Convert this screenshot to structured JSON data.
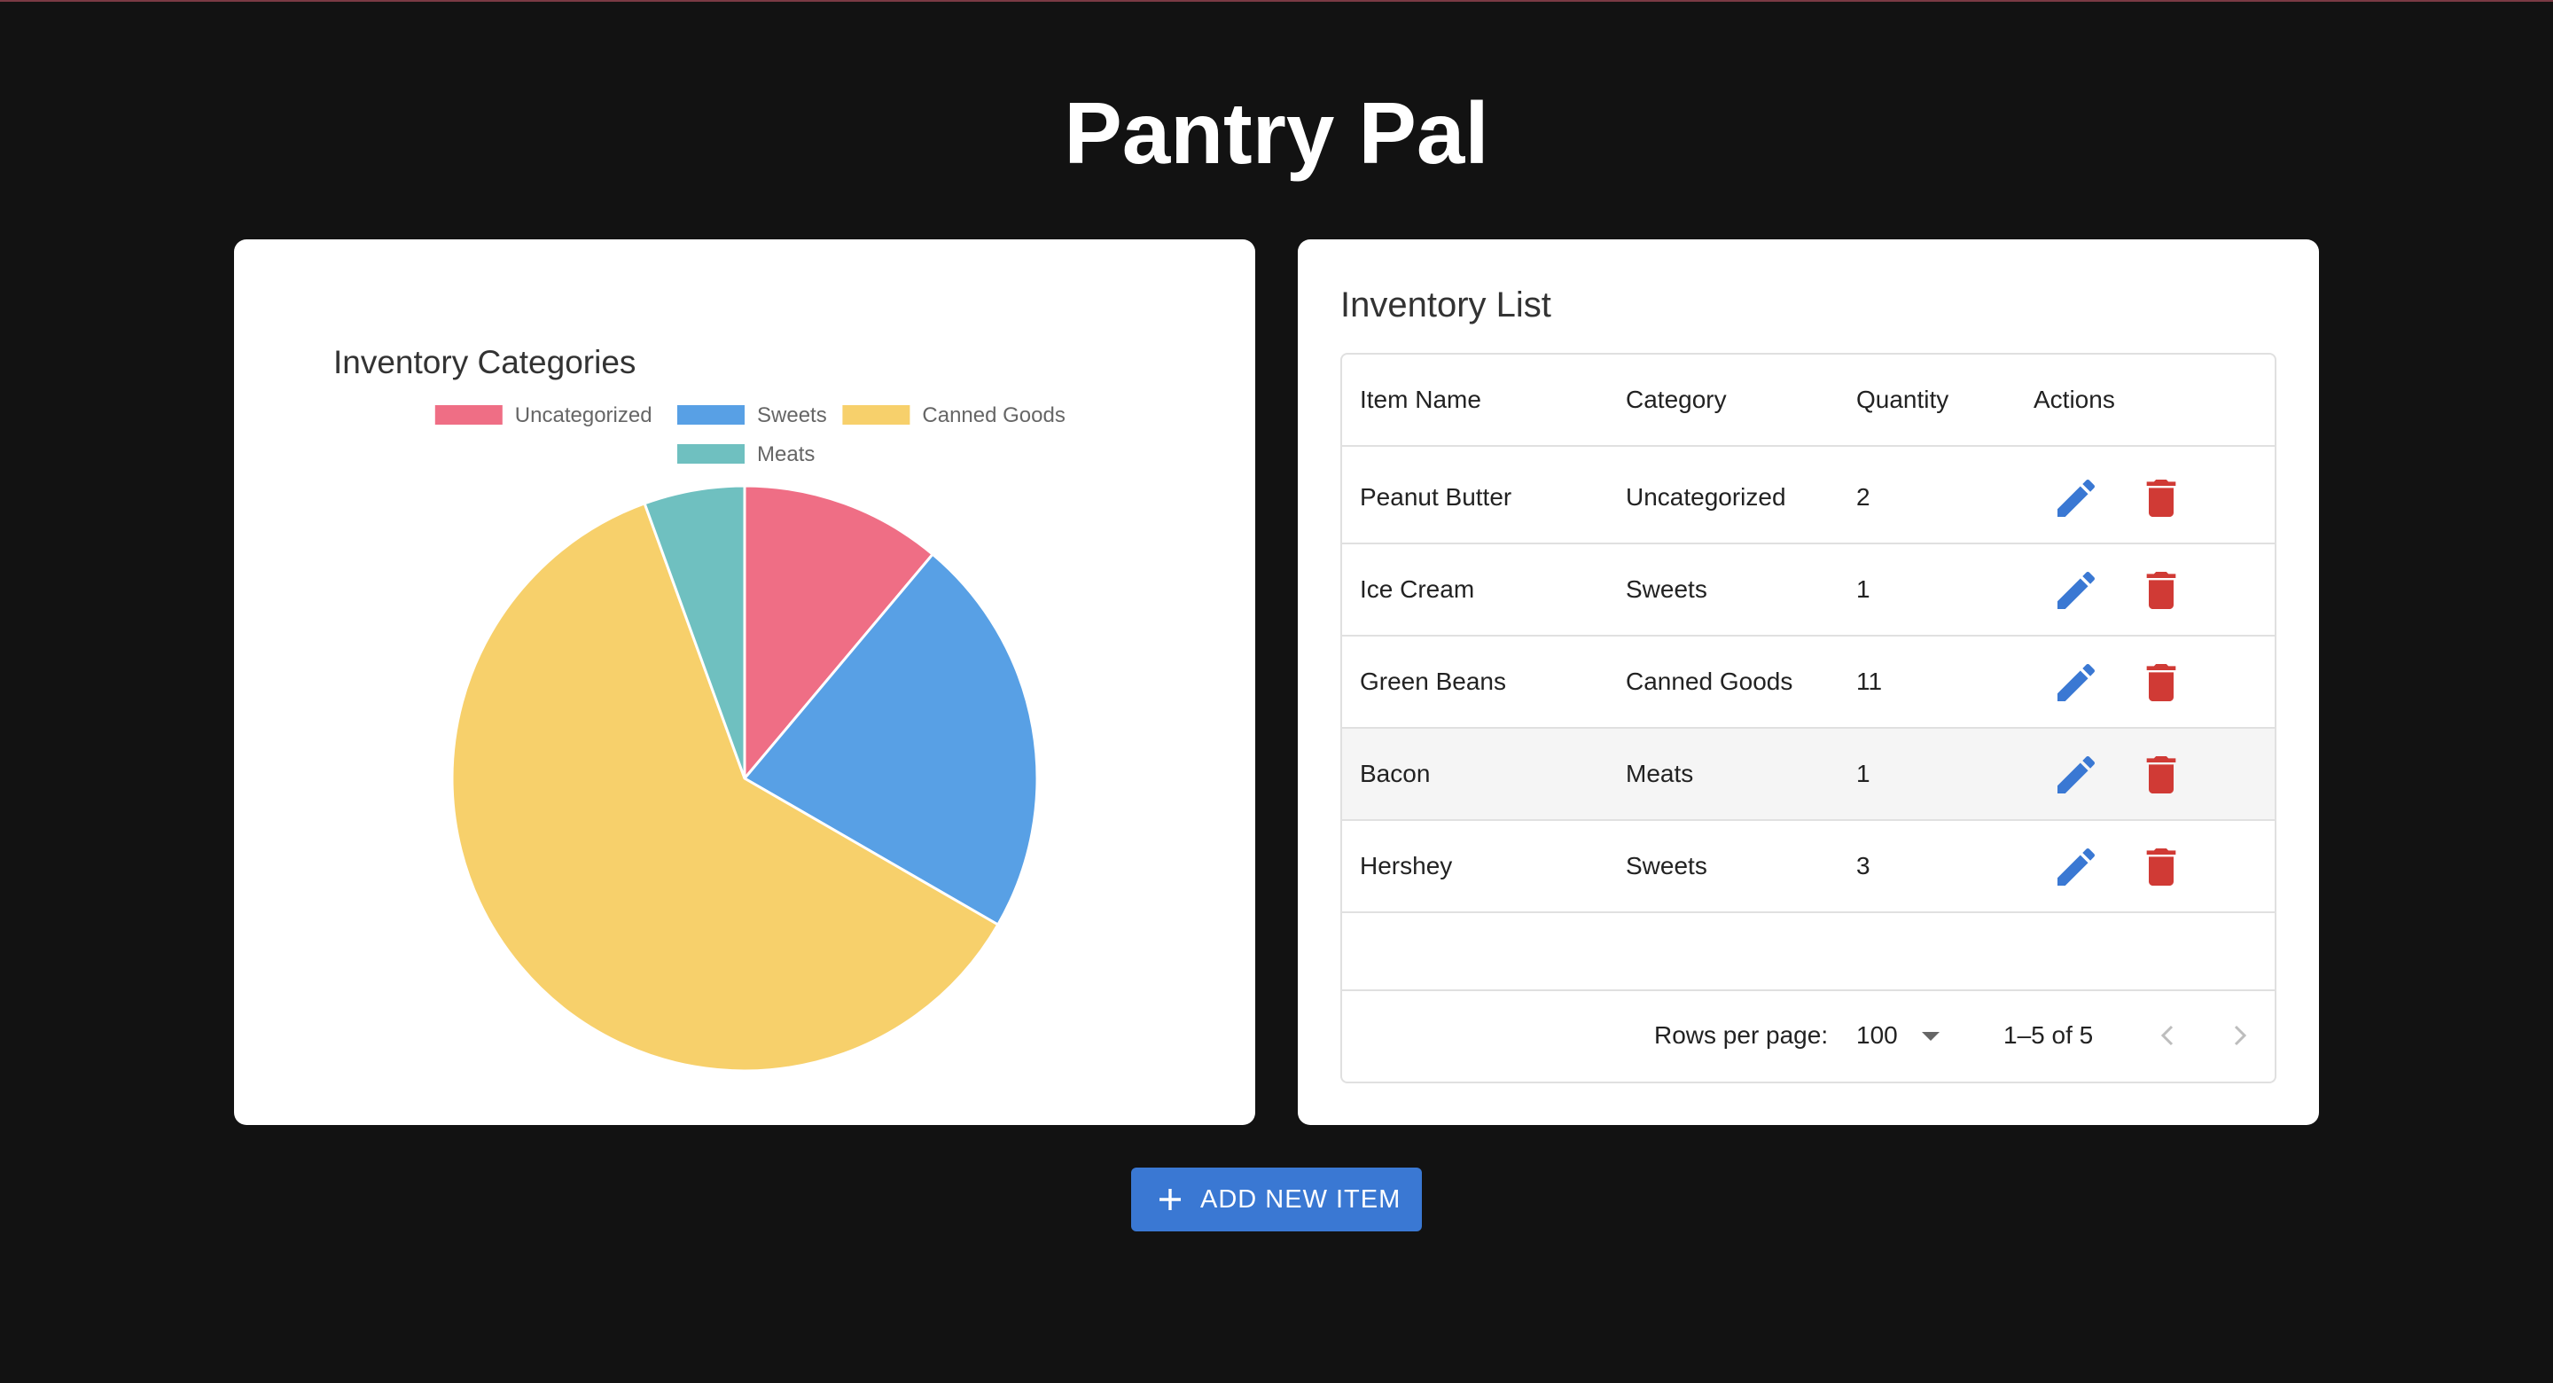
{
  "app": {
    "title": "Pantry Pal"
  },
  "colors": {
    "uncategorized": "#ef6e85",
    "sweets": "#58a0e5",
    "canned_goods": "#f7d06b",
    "meats": "#6fc0c0",
    "edit": "#3a78d3",
    "delete": "#d03a35",
    "button": "#3a78d3"
  },
  "chart_data": {
    "type": "pie",
    "title": "Inventory Categories",
    "categories": [
      "Uncategorized",
      "Sweets",
      "Canned Goods",
      "Meats"
    ],
    "values": [
      2,
      4,
      11,
      1
    ],
    "colors": [
      "#ef6e85",
      "#58a0e5",
      "#f7d06b",
      "#6fc0c0"
    ],
    "legend": "top"
  },
  "inventory": {
    "title": "Inventory List",
    "columns": [
      "Item Name",
      "Category",
      "Quantity",
      "Actions"
    ],
    "rows": [
      {
        "name": "Peanut Butter",
        "category": "Uncategorized",
        "quantity": "2"
      },
      {
        "name": "Ice Cream",
        "category": "Sweets",
        "quantity": "1"
      },
      {
        "name": "Green Beans",
        "category": "Canned Goods",
        "quantity": "11"
      },
      {
        "name": "Bacon",
        "category": "Meats",
        "quantity": "1"
      },
      {
        "name": "Hershey",
        "category": "Sweets",
        "quantity": "3"
      }
    ],
    "pagination": {
      "rows_per_page_label": "Rows per page:",
      "rows_per_page": "100",
      "range": "1–5 of 5"
    },
    "icons": {
      "edit": "pencil-icon",
      "delete": "trash-icon",
      "prev": "chevron-left-icon",
      "next": "chevron-right-icon"
    }
  },
  "actions": {
    "add_label": "ADD NEW ITEM",
    "add_icon": "plus-icon"
  }
}
